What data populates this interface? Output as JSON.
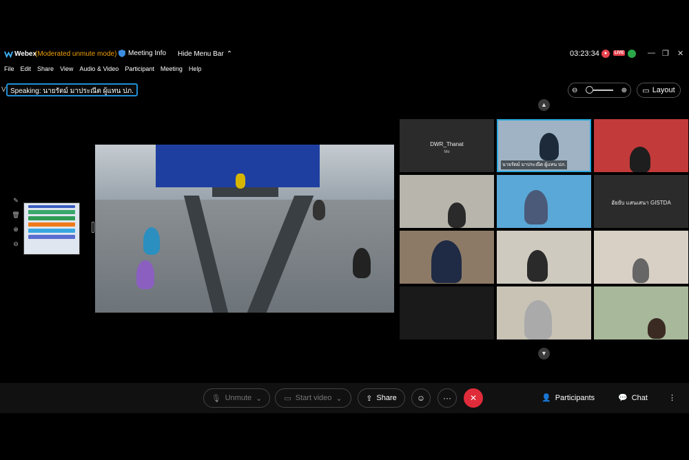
{
  "titlebar": {
    "app_name": "Webex",
    "mode": "(Moderated unmute mode)",
    "meeting_info": "Meeting Info",
    "hide_menu": "Hide Menu Bar",
    "clock": "03:23:34",
    "live": "LIVE",
    "icons": [
      "webex-logo-icon",
      "shield-icon",
      "chevron-up-icon",
      "record-icon",
      "signal-icon",
      "minimize-icon",
      "restore-icon",
      "close-icon"
    ]
  },
  "menu": [
    "File",
    "Edit",
    "Share",
    "View",
    "Audio & Video",
    "Participant",
    "Meeting",
    "Help"
  ],
  "speaking": "Speaking: นายรัตม์ มาประณีต ผู้แทน ปภ.",
  "side_letter": "V",
  "layout_label": "Layout",
  "participants": [
    {
      "name": "DWR_Thanat",
      "sub": "Me",
      "video": false
    },
    {
      "name": "นายรัตม์ มาประณีต ผู้แทน ปภ.",
      "video": true,
      "active": true
    },
    {
      "name": "",
      "video": true
    },
    {
      "name": "",
      "video": true
    },
    {
      "name": "",
      "video": true
    },
    {
      "name": "อัยยับ แสนเสนา GISTDA",
      "video": false
    },
    {
      "name": "",
      "video": true
    },
    {
      "name": "",
      "video": true
    },
    {
      "name": "",
      "video": true
    },
    {
      "name": "",
      "video": false
    },
    {
      "name": "",
      "video": true
    },
    {
      "name": "",
      "video": true
    }
  ],
  "toolbar": {
    "unmute": "Unmute",
    "start_video": "Start video",
    "share": "Share",
    "participants": "Participants",
    "chat": "Chat",
    "more": "···",
    "leave": "✕"
  },
  "colors": {
    "accent": "#1f8fd6",
    "mode": "#f0a000",
    "leave": "#e02c3a",
    "live": "#e8434f"
  }
}
